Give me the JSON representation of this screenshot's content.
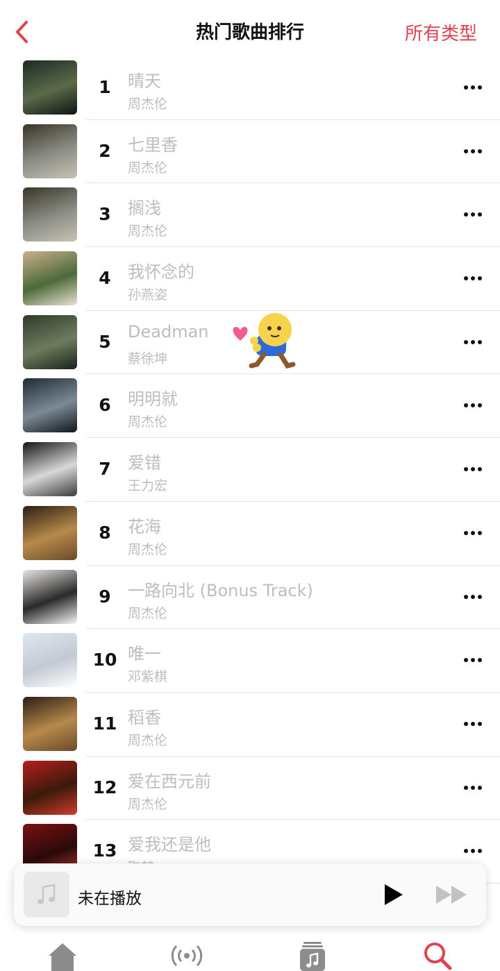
{
  "header": {
    "title": "热门歌曲排行",
    "genre_button": "所有类型",
    "accent_color": "#e0424f"
  },
  "songs": [
    {
      "rank": "1",
      "title": "晴天",
      "artist": "周杰伦"
    },
    {
      "rank": "2",
      "title": "七里香",
      "artist": "周杰伦"
    },
    {
      "rank": "3",
      "title": "搁浅",
      "artist": "周杰伦"
    },
    {
      "rank": "4",
      "title": "我怀念的",
      "artist": "孙燕姿"
    },
    {
      "rank": "5",
      "title": "Deadman",
      "artist": "蔡徐坤"
    },
    {
      "rank": "6",
      "title": "明明就",
      "artist": "周杰伦"
    },
    {
      "rank": "7",
      "title": "爱错",
      "artist": "王力宏"
    },
    {
      "rank": "8",
      "title": "花海",
      "artist": "周杰伦"
    },
    {
      "rank": "9",
      "title": "一路向北 (Bonus Track)",
      "artist": "周杰伦"
    },
    {
      "rank": "10",
      "title": "唯一",
      "artist": "邓紫棋"
    },
    {
      "rank": "11",
      "title": "稻香",
      "artist": "周杰伦"
    },
    {
      "rank": "12",
      "title": "爱在西元前",
      "artist": "周杰伦"
    },
    {
      "rank": "13",
      "title": "爱我还是他",
      "artist": "陶喆"
    }
  ],
  "player": {
    "status": "未在播放"
  },
  "tabbar": {
    "items": [
      "home-icon",
      "radio-icon",
      "library-icon",
      "search-icon"
    ]
  }
}
